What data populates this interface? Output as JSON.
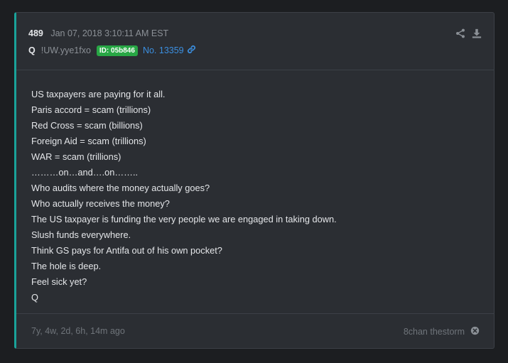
{
  "post": {
    "number": "489",
    "timestamp": "Jan 07, 2018 3:10:11 AM EST",
    "author": "Q",
    "tripcode": "!UW.yye1fxo",
    "id_badge": "ID: 05b846",
    "post_no": "No. 13359",
    "icons": [
      "share-icon",
      "download-icon",
      "link-icon",
      "close-circle-icon"
    ],
    "colors": {
      "accent": "#1aa39a",
      "badge": "#28a745",
      "link": "#3b8fe0",
      "background": "#2b2e33"
    },
    "lines": [
      "US taxpayers are paying for it all.",
      "Paris accord = scam (trillions)",
      "Red Cross = scam (billions)",
      "Foreign Aid = scam (trillions)",
      "WAR = scam (trillions)",
      "………on…and….on……..",
      "Who audits where the money actually goes?",
      "Who actually receives the money?",
      "The US taxpayer is funding the very people we are engaged in taking down.",
      "Slush funds everywhere.",
      "Think GS pays for Antifa out of his own pocket?",
      "The hole is deep.",
      "Feel sick yet?",
      "Q"
    ]
  },
  "footer": {
    "time_ago": "7y, 4w, 2d, 6h, 14m ago",
    "source": "8chan thestorm"
  }
}
